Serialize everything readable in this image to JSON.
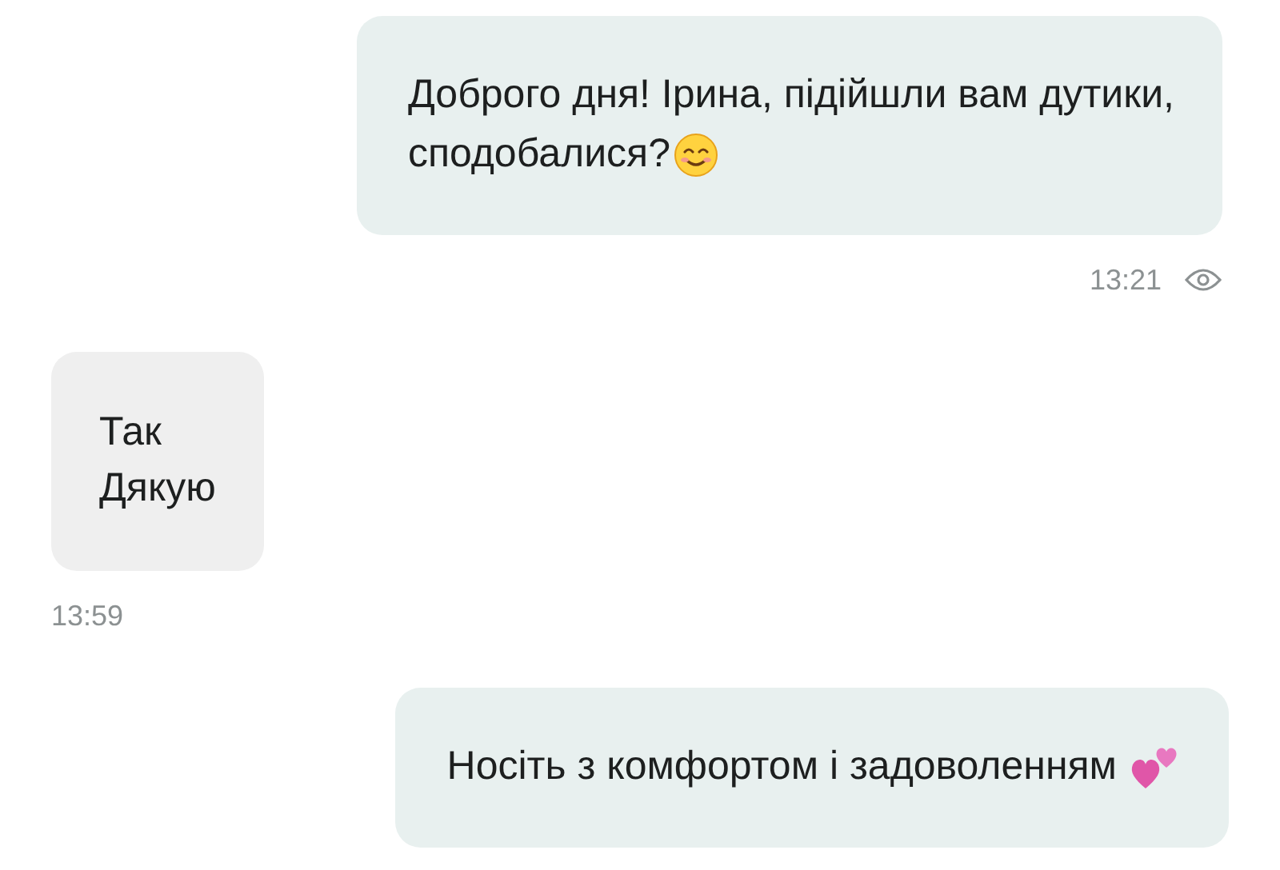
{
  "messages": [
    {
      "kind": "outgoing",
      "lines": [
        "Доброго дня! Ірина, підійшли вам дутики,",
        "сподобалися?"
      ],
      "end_icon": {
        "kind": "smile"
      },
      "time": "13:21",
      "seen": true
    },
    {
      "kind": "incoming",
      "lines": [
        "Так",
        "Дякую"
      ],
      "time": "13:59"
    },
    {
      "kind": "outgoing",
      "lines": [
        "Носіть з комфортом і задоволенням"
      ],
      "end_icon": {
        "kind": "hearts"
      }
    }
  ]
}
